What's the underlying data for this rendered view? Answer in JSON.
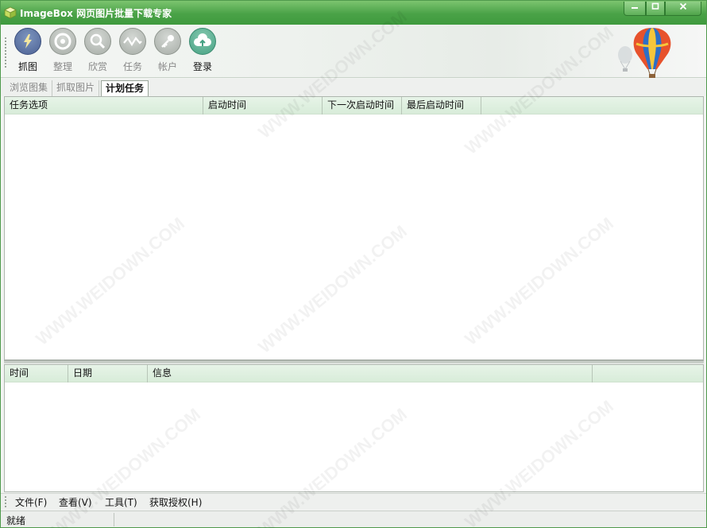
{
  "window": {
    "title": "ImageBox 网页图片批量下载专家",
    "controls": [
      "minimize",
      "maximize",
      "close"
    ]
  },
  "toolbar": {
    "items": [
      {
        "label": "抓图",
        "icon": "lightning-icon",
        "active": true
      },
      {
        "label": "整理",
        "icon": "disc-icon",
        "active": false
      },
      {
        "label": "欣赏",
        "icon": "magnifier-icon",
        "active": false
      },
      {
        "label": "任务",
        "icon": "waveform-icon",
        "active": false
      },
      {
        "label": "帐户",
        "icon": "key-icon",
        "active": false
      },
      {
        "label": "登录",
        "icon": "cloud-upload-icon",
        "active": false
      }
    ]
  },
  "tabs": [
    {
      "label": "浏览图集",
      "active": false
    },
    {
      "label": "抓取图片",
      "active": false
    },
    {
      "label": "计划任务",
      "active": true
    }
  ],
  "task_table": {
    "columns": [
      "任务选项",
      "启动时间",
      "下一次启动时间",
      "最后启动时间"
    ],
    "rows": []
  },
  "log_table": {
    "columns": [
      "时间",
      "日期",
      "信息"
    ],
    "rows": []
  },
  "menu": [
    "文件(F)",
    "查看(V)",
    "工具(T)",
    "获取授权(H)"
  ],
  "status": {
    "text": "就绪"
  },
  "watermark": "WWW.WEIDOWN.COM",
  "colors": {
    "titlebar": "#4aa247",
    "header": "#d8ecd9",
    "accent_login": "#46a183"
  }
}
